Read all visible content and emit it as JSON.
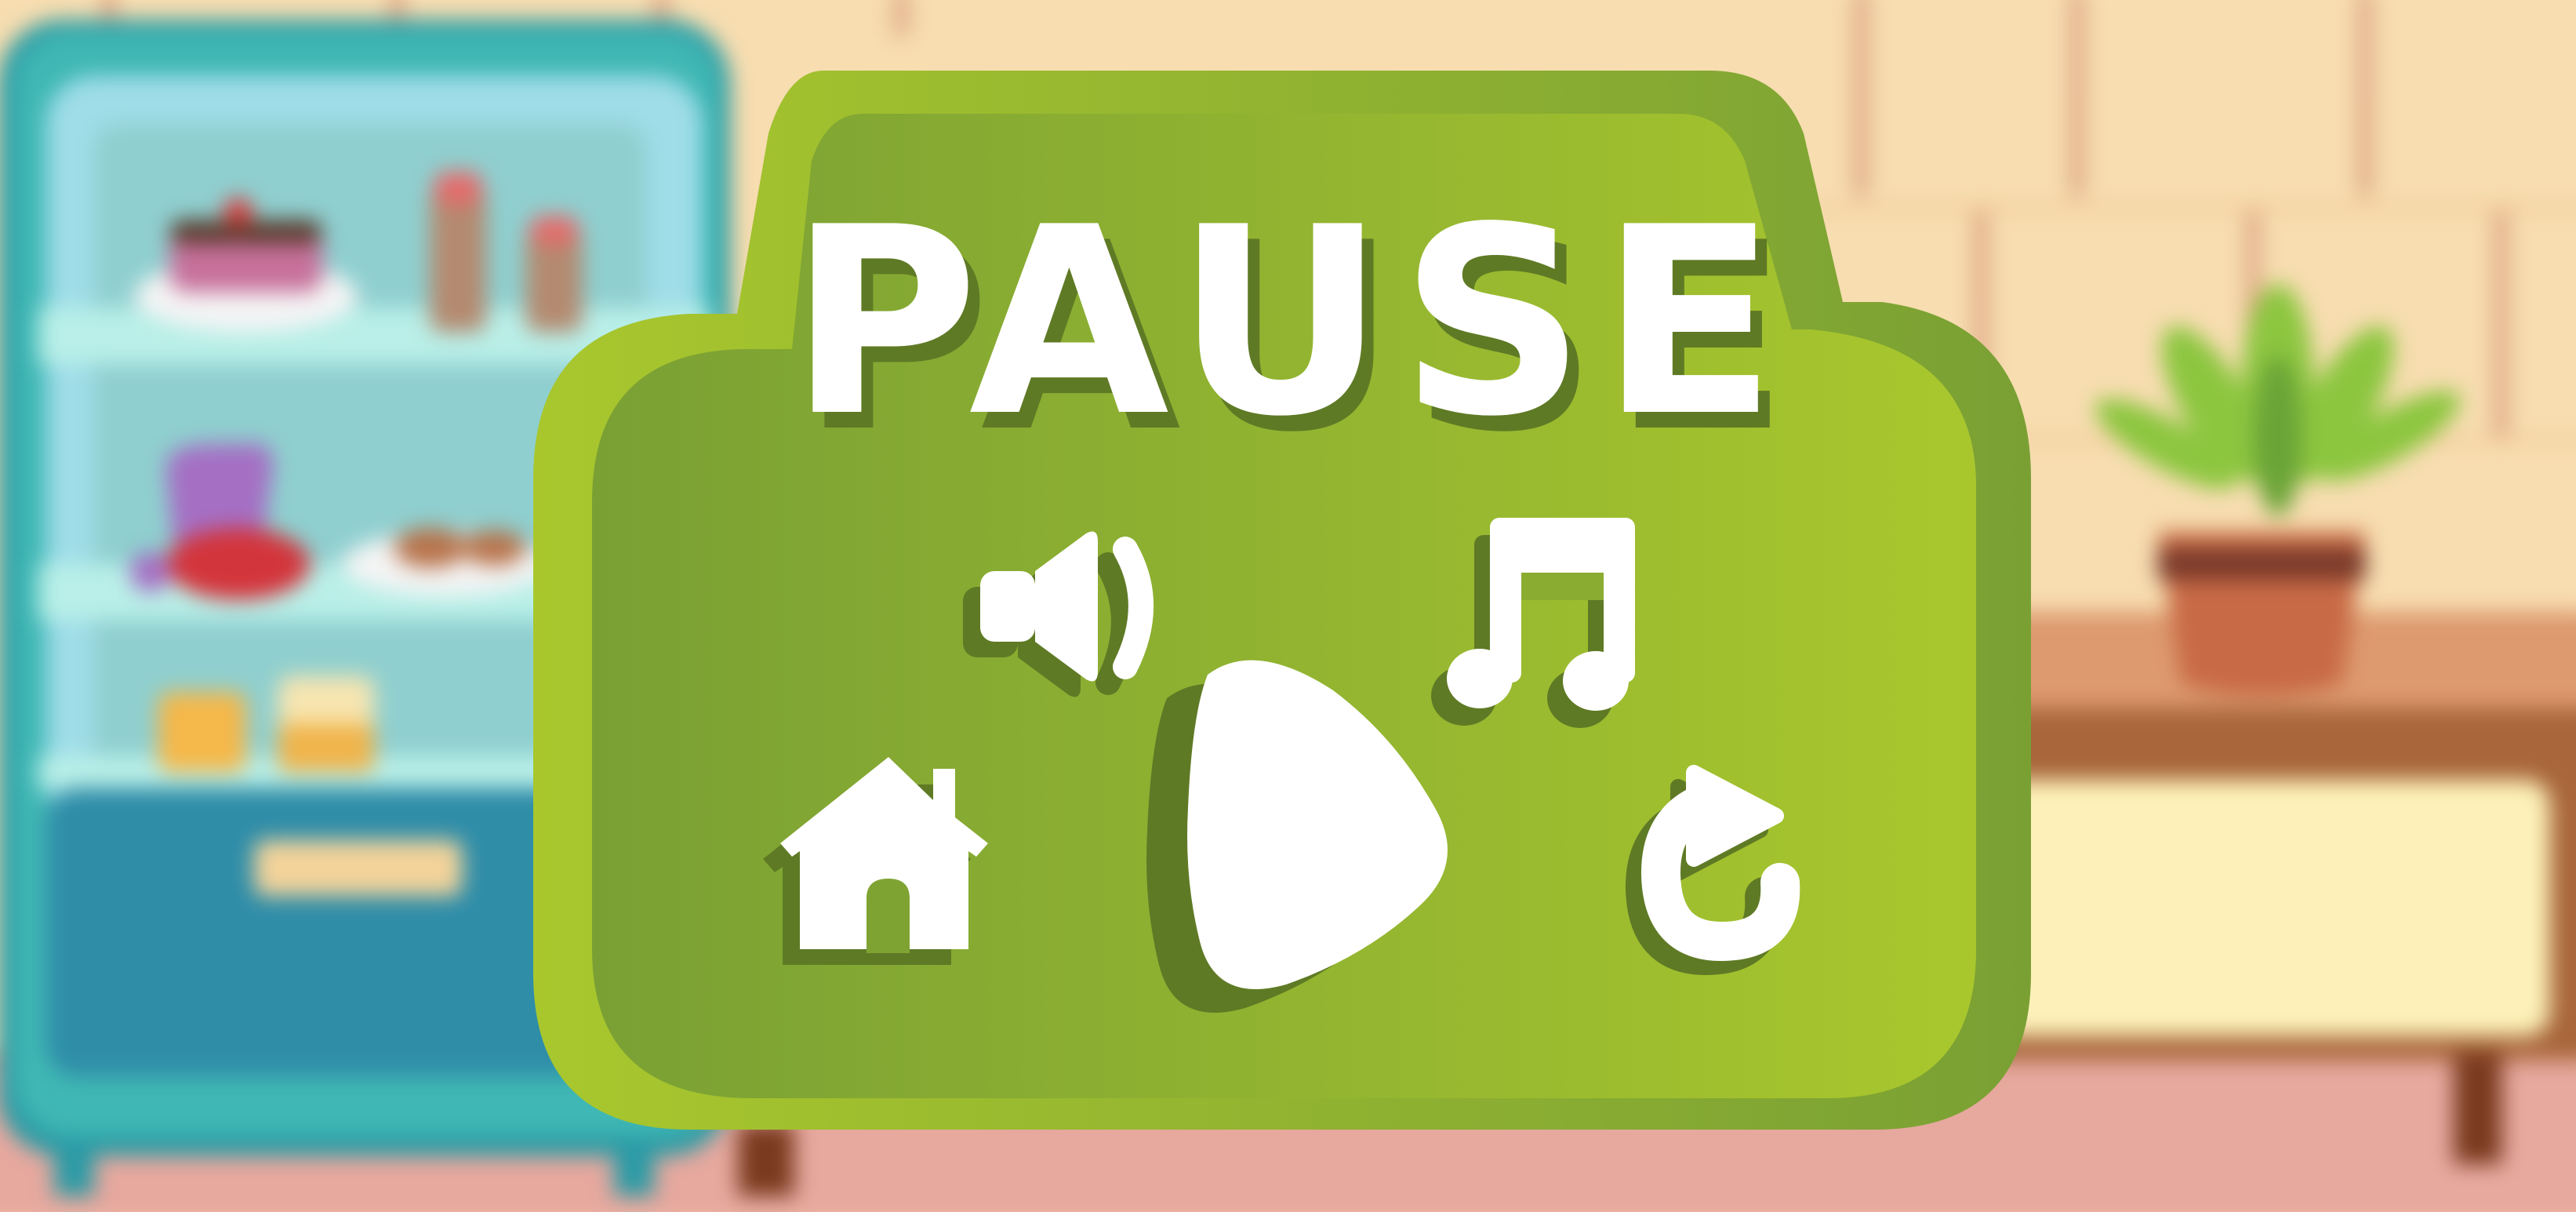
{
  "pause_menu": {
    "title": "PAUSE",
    "buttons": [
      {
        "id": "sound",
        "icon": "speaker-icon"
      },
      {
        "id": "music",
        "icon": "music-note-icon"
      },
      {
        "id": "home",
        "icon": "home-icon"
      },
      {
        "id": "resume",
        "icon": "play-icon"
      },
      {
        "id": "restart",
        "icon": "restart-icon"
      }
    ]
  },
  "colors": {
    "panel_light": "#a9c72d",
    "panel_dark": "#7aa034",
    "panel_shadow": "#6e8a2c",
    "icon_fill": "#ffffff",
    "icon_shadow": "#5f7a25",
    "wall": "#f7ddb0",
    "floor": "#e7a89e",
    "cabinet": "#3fb3b3",
    "dresser": "#a8663a"
  }
}
